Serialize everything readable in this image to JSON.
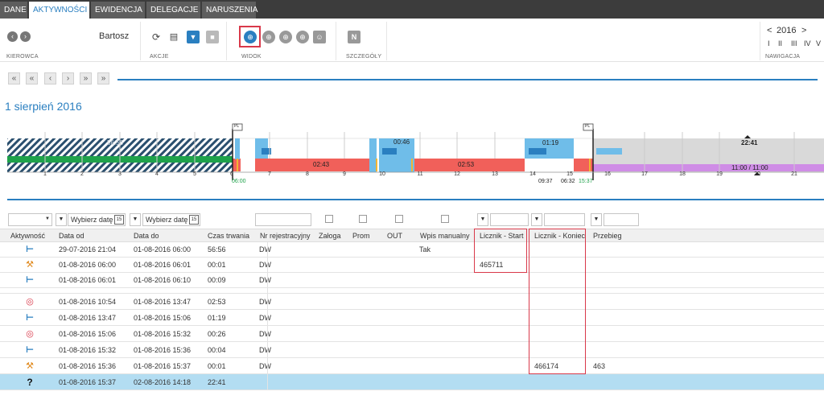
{
  "tabs": [
    "DANE",
    "AKTYWNOŚCI",
    "EWIDENCJA",
    "DELEGACJE",
    "NARUSZENIA"
  ],
  "active_tab": "AKTYWNOŚCI",
  "ribbon": {
    "driver_name": "Bartosz",
    "groups": {
      "kierowca": "KIEROWCA",
      "akcje": "AKCJE",
      "widok": "WIDOK",
      "szczegoly": "SZCZEGÓŁY",
      "nawigacja": "NAWIGACJA"
    },
    "year": "2016",
    "year_prev": "<",
    "year_next": ">",
    "quarters": [
      "I",
      "II",
      "III",
      "IV",
      "V"
    ]
  },
  "nav_buttons": [
    "«",
    "«",
    "‹",
    "›",
    "»",
    "»"
  ],
  "date_title": "1 sierpień 2016",
  "timeline": {
    "hour_ticks": [
      "1",
      "2",
      "3",
      "4",
      "5",
      "6",
      "7",
      "8",
      "9",
      "10",
      "11",
      "12",
      "13",
      "14",
      "15",
      "16",
      "17",
      "18",
      "19",
      "20",
      "21"
    ],
    "labels": {
      "rest_main": "56:56",
      "drive_1": "02:43",
      "drive_2": "02:53",
      "rest_1": "00:46",
      "rest_2": "01:19",
      "unknown": "22:41",
      "purple": "11:00 / 11:00",
      "start_time": "06:00",
      "sum_label": "09:37",
      "drive_sum": "06:32",
      "end_time": "15:37",
      "pl_flag_1": "PL",
      "pl_flag_2": "PL"
    },
    "colors": {
      "rest": "#6fbde9",
      "drive": "#f1605a",
      "green": "#1fa24b",
      "purple": "#cf8de6",
      "grey": "#d9d9d9",
      "hatch": "#2a4f6e",
      "yellow": "#f2b533"
    }
  },
  "filters": {
    "date_placeholder_1": "Wybierz datę",
    "date_placeholder_2": "Wybierz datę",
    "cal_icon": "15"
  },
  "columns": [
    "Aktywność",
    "Data od",
    "Data do",
    "Czas trwania",
    "Nr rejestracyjny",
    "Załoga",
    "Prom",
    "OUT",
    "Wpis manualny",
    "Licznik - Start",
    "Licznik - Koniec",
    "Przebieg"
  ],
  "rows": [
    {
      "icon": "rest",
      "from": "29-07-2016 21:04",
      "to": "01-08-2016 06:00",
      "dur": "56:56",
      "reg": "DW",
      "manual": "Tak",
      "start": "",
      "end": "",
      "mileage": ""
    },
    {
      "icon": "work",
      "from": "01-08-2016 06:00",
      "to": "01-08-2016 06:01",
      "dur": "00:01",
      "reg": "DW",
      "manual": "",
      "start": "465711",
      "end": "",
      "mileage": ""
    },
    {
      "icon": "rest",
      "from": "01-08-2016 06:01",
      "to": "01-08-2016 06:10",
      "dur": "00:09",
      "reg": "DW",
      "manual": "",
      "start": "",
      "end": "",
      "mileage": ""
    },
    {
      "icon": "drive",
      "from": "01-08-2016 10:54",
      "to": "01-08-2016 13:47",
      "dur": "02:53",
      "reg": "DW",
      "manual": "",
      "start": "",
      "end": "",
      "mileage": ""
    },
    {
      "icon": "rest",
      "from": "01-08-2016 13:47",
      "to": "01-08-2016 15:06",
      "dur": "01:19",
      "reg": "DW",
      "manual": "",
      "start": "",
      "end": "",
      "mileage": ""
    },
    {
      "icon": "drive",
      "from": "01-08-2016 15:06",
      "to": "01-08-2016 15:32",
      "dur": "00:26",
      "reg": "DW",
      "manual": "",
      "start": "",
      "end": "",
      "mileage": ""
    },
    {
      "icon": "rest",
      "from": "01-08-2016 15:32",
      "to": "01-08-2016 15:36",
      "dur": "00:04",
      "reg": "DW",
      "manual": "",
      "start": "",
      "end": "",
      "mileage": ""
    },
    {
      "icon": "work",
      "from": "01-08-2016 15:36",
      "to": "01-08-2016 15:37",
      "dur": "00:01",
      "reg": "DW",
      "manual": "",
      "start": "",
      "end": "466174",
      "mileage": "463"
    },
    {
      "icon": "unknown",
      "from": "01-08-2016 15:37",
      "to": "02-08-2016 14:18",
      "dur": "22:41",
      "reg": "",
      "manual": "",
      "start": "",
      "end": "",
      "mileage": ""
    }
  ],
  "icons": {
    "rest": "bed-icon",
    "work": "hammers-icon",
    "drive": "steering-wheel-icon",
    "unknown": "question-icon",
    "rest_glyph": "⊢",
    "work_glyph": "⚒",
    "drive_glyph": "◎",
    "unknown_glyph": "?"
  }
}
